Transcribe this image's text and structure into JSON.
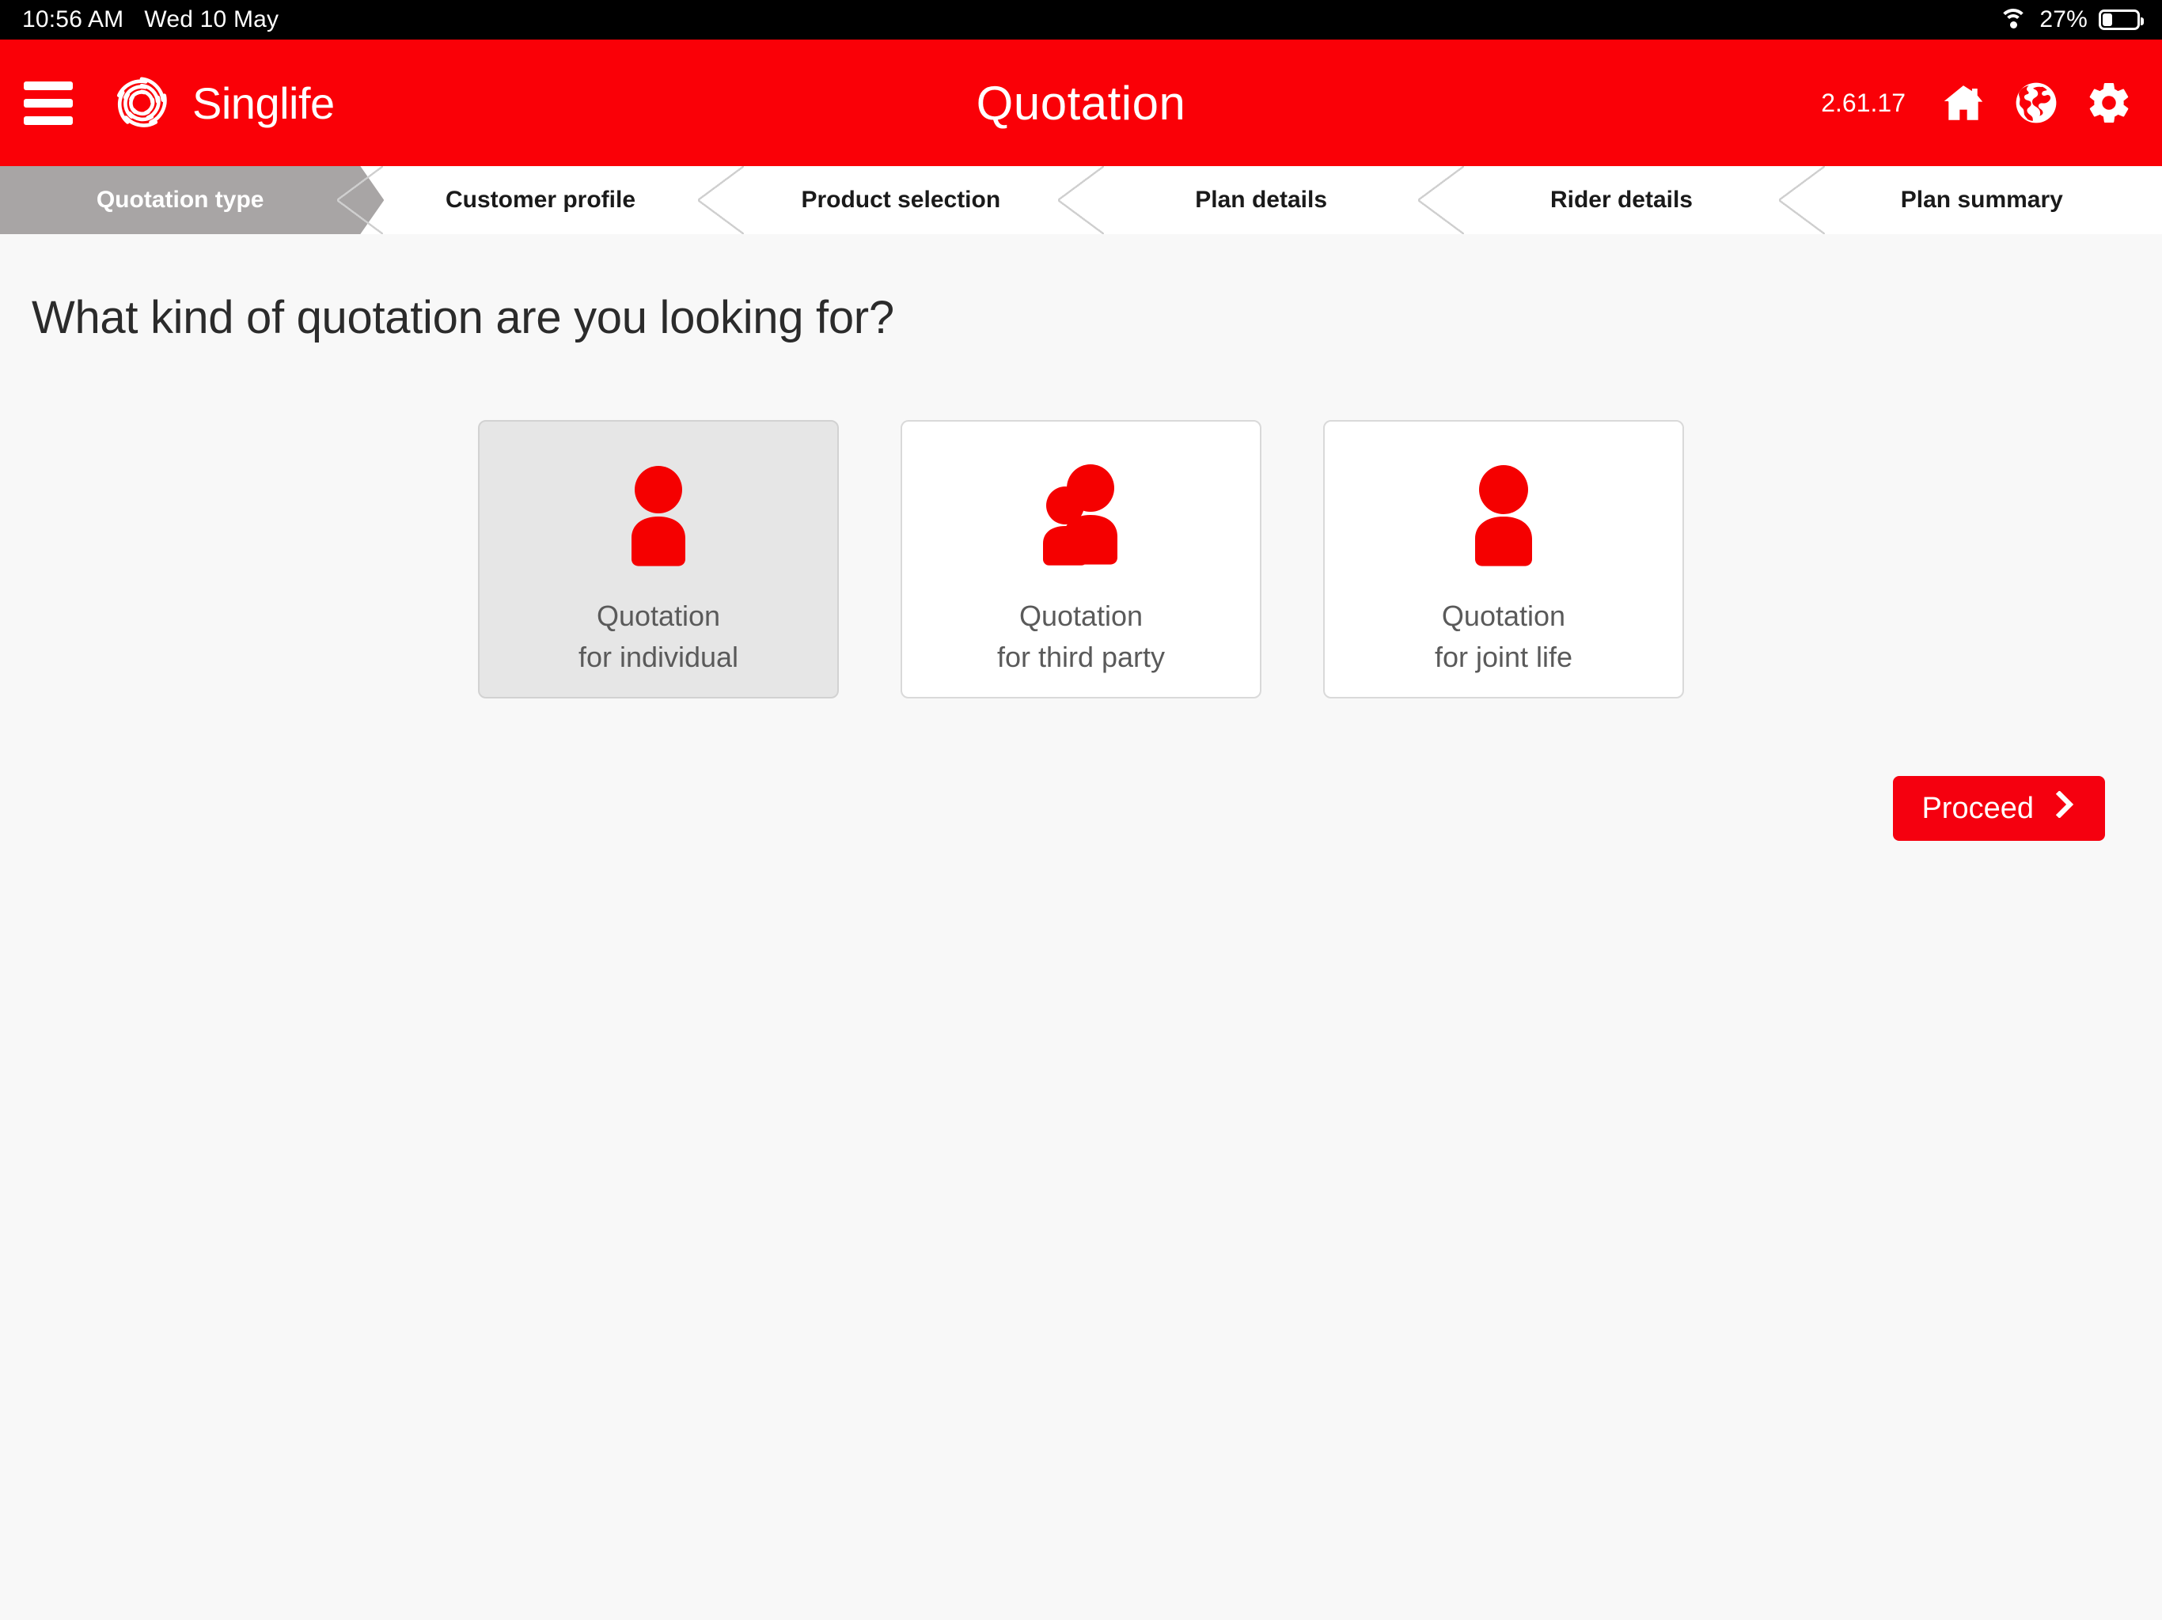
{
  "status_bar": {
    "time": "10:56 AM",
    "date": "Wed 10 May",
    "battery_percent": "27%",
    "wifi_icon": "wifi-icon",
    "battery_icon": "battery-icon"
  },
  "app_bar": {
    "menu_icon": "hamburger-menu-icon",
    "brand": "Singlife",
    "brand_logo_icon": "singlife-swirl-logo",
    "title": "Quotation",
    "version": "2.61.17",
    "home_icon": "home-icon",
    "globe_icon": "globe-icon",
    "settings_icon": "gear-icon",
    "background_color": "#fa0007"
  },
  "stepper": {
    "active_index": 0,
    "active_color": "#a8a5a5",
    "steps": [
      {
        "label": "Quotation type"
      },
      {
        "label": "Customer profile"
      },
      {
        "label": "Product selection"
      },
      {
        "label": "Plan details"
      },
      {
        "label": "Rider details"
      },
      {
        "label": "Plan summary"
      }
    ]
  },
  "main": {
    "heading": "What kind of quotation are you looking for?",
    "cards": [
      {
        "line1": "Quotation",
        "line2": "for individual",
        "icon": "single-person-icon",
        "selected": true
      },
      {
        "line1": "Quotation",
        "line2": "for third party",
        "icon": "two-people-icon",
        "selected": false
      },
      {
        "line1": "Quotation",
        "line2": "for joint life",
        "icon": "single-person-icon",
        "selected": false
      }
    ],
    "proceed_label": "Proceed",
    "proceed_icon": "chevron-right-icon",
    "accent_color": "#f5000f",
    "icon_color": "#f50000"
  }
}
